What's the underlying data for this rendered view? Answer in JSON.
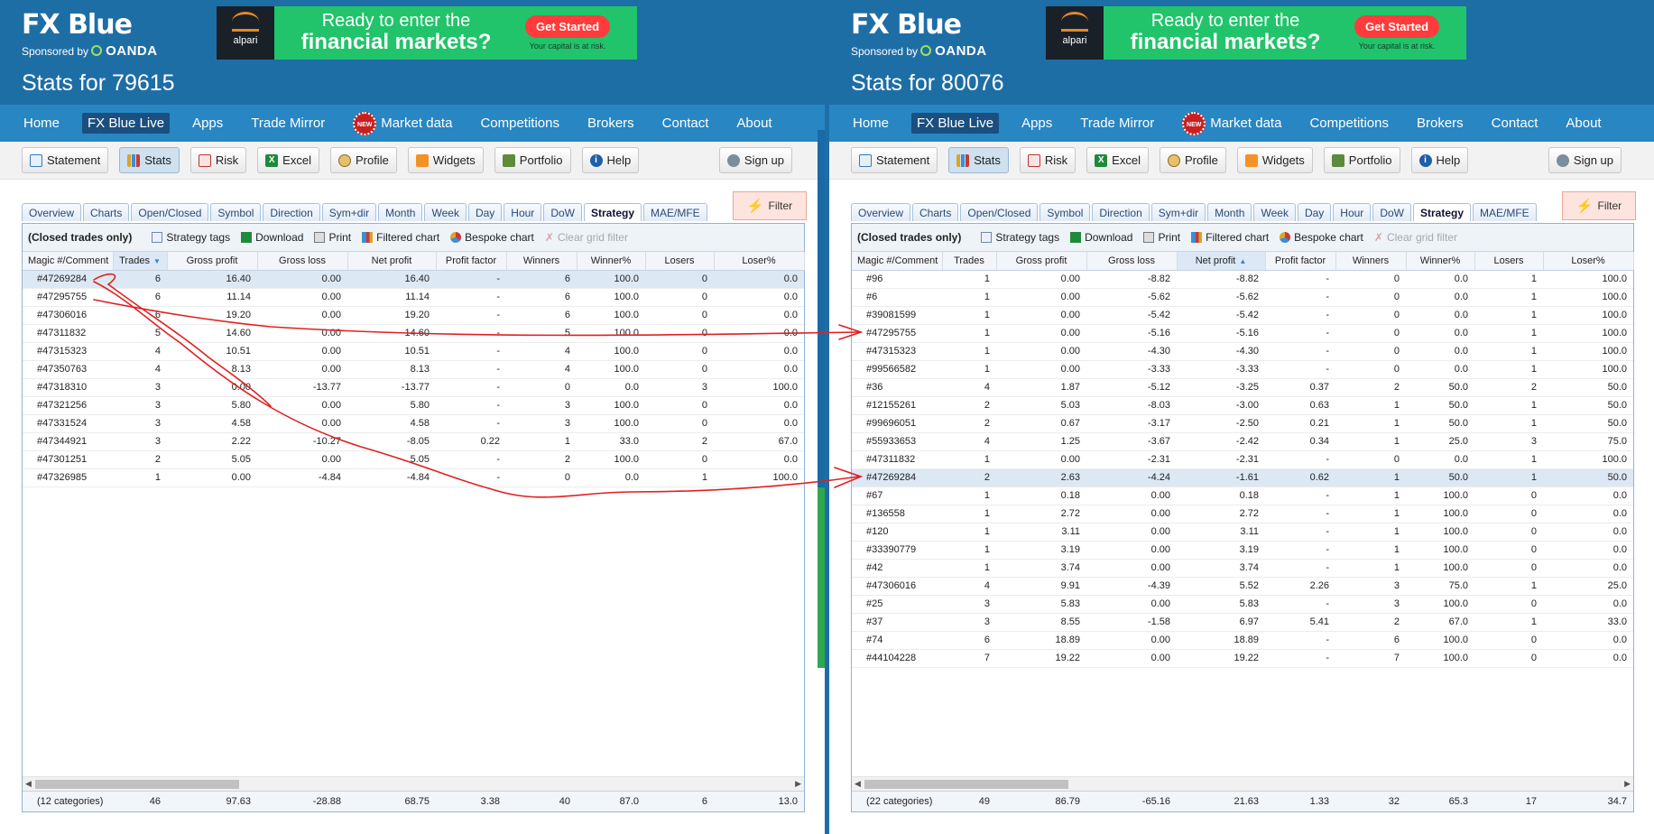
{
  "brand": {
    "logo": "FX Blue",
    "sponsored_by": "Sponsored by",
    "sponsor": "OANDA"
  },
  "ad": {
    "logo_text": "alpari",
    "line1": "Ready to enter the",
    "line2": "financial markets?",
    "button": "Get Started",
    "disclaimer": "Your capital is at risk."
  },
  "nav": [
    {
      "label": "Home",
      "active": false
    },
    {
      "label": "FX Blue Live",
      "active": true
    },
    {
      "label": "Apps",
      "active": false
    },
    {
      "label": "Trade Mirror",
      "active": false
    },
    {
      "label": "Market data",
      "active": false,
      "badge": "NEW"
    },
    {
      "label": "Competitions",
      "active": false
    },
    {
      "label": "Brokers",
      "active": false
    },
    {
      "label": "Contact",
      "active": false
    },
    {
      "label": "About",
      "active": false
    }
  ],
  "toolbar": [
    {
      "label": "Statement",
      "icon": "doc"
    },
    {
      "label": "Stats",
      "icon": "bars",
      "active": true
    },
    {
      "label": "Risk",
      "icon": "risk"
    },
    {
      "label": "Excel",
      "icon": "xl"
    },
    {
      "label": "Profile",
      "icon": "prof"
    },
    {
      "label": "Widgets",
      "icon": "rss"
    },
    {
      "label": "Portfolio",
      "icon": "port"
    },
    {
      "label": "Help",
      "icon": "help"
    }
  ],
  "signup": "Sign up",
  "tabs": [
    "Overview",
    "Charts",
    "Open/Closed",
    "Symbol",
    "Direction",
    "Sym+dir",
    "Month",
    "Week",
    "Day",
    "Hour",
    "DoW",
    "Strategy",
    "MAE/MFE"
  ],
  "active_tab": "Strategy",
  "filter": "Filter",
  "grid_toolbar": {
    "closed_only": "(Closed trades only)",
    "strategy_tags": "Strategy tags",
    "download": "Download",
    "print": "Print",
    "filtered_chart": "Filtered chart",
    "bespoke_chart": "Bespoke chart",
    "clear_filter": "Clear grid filter"
  },
  "columns": [
    "Magic #/Comment",
    "Trades",
    "Gross profit",
    "Gross loss",
    "Net profit",
    "Profit factor",
    "Winners",
    "Winner%",
    "Losers",
    "Loser%"
  ],
  "colors": {
    "header_blue": "#1e6ea6",
    "nav_blue": "#2886c3",
    "arrow_red": "#e02020",
    "ad_green": "#21c46a"
  },
  "panels": [
    {
      "title": "Stats for 79615",
      "sort_col": 1,
      "sort_dir": "desc",
      "rows": [
        [
          "#47269284",
          "6",
          "16.40",
          "0.00",
          "16.40",
          "-",
          "6",
          "100.0",
          "0",
          "0.0"
        ],
        [
          "#47295755",
          "6",
          "11.14",
          "0.00",
          "11.14",
          "-",
          "6",
          "100.0",
          "0",
          "0.0"
        ],
        [
          "#47306016",
          "6",
          "19.20",
          "0.00",
          "19.20",
          "-",
          "6",
          "100.0",
          "0",
          "0.0"
        ],
        [
          "#47311832",
          "5",
          "14.60",
          "0.00",
          "14.60",
          "-",
          "5",
          "100.0",
          "0",
          "0.0"
        ],
        [
          "#47315323",
          "4",
          "10.51",
          "0.00",
          "10.51",
          "-",
          "4",
          "100.0",
          "0",
          "0.0"
        ],
        [
          "#47350763",
          "4",
          "8.13",
          "0.00",
          "8.13",
          "-",
          "4",
          "100.0",
          "0",
          "0.0"
        ],
        [
          "#47318310",
          "3",
          "0.00",
          "-13.77",
          "-13.77",
          "-",
          "0",
          "0.0",
          "3",
          "100.0"
        ],
        [
          "#47321256",
          "3",
          "5.80",
          "0.00",
          "5.80",
          "-",
          "3",
          "100.0",
          "0",
          "0.0"
        ],
        [
          "#47331524",
          "3",
          "4.58",
          "0.00",
          "4.58",
          "-",
          "3",
          "100.0",
          "0",
          "0.0"
        ],
        [
          "#47344921",
          "3",
          "2.22",
          "-10.27",
          "-8.05",
          "0.22",
          "1",
          "33.0",
          "2",
          "67.0"
        ],
        [
          "#47301251",
          "2",
          "5.05",
          "0.00",
          "5.05",
          "-",
          "2",
          "100.0",
          "0",
          "0.0"
        ],
        [
          "#47326985",
          "1",
          "0.00",
          "-4.84",
          "-4.84",
          "-",
          "0",
          "0.0",
          "1",
          "100.0"
        ]
      ],
      "selected_row": 0,
      "footer": [
        "(12 categories)",
        "46",
        "97.63",
        "-28.88",
        "68.75",
        "3.38",
        "40",
        "87.0",
        "6",
        "13.0"
      ]
    },
    {
      "title": "Stats for 80076",
      "sort_col": 4,
      "sort_dir": "asc",
      "rows": [
        [
          "#96",
          "1",
          "0.00",
          "-8.82",
          "-8.82",
          "-",
          "0",
          "0.0",
          "1",
          "100.0"
        ],
        [
          "#6",
          "1",
          "0.00",
          "-5.62",
          "-5.62",
          "-",
          "0",
          "0.0",
          "1",
          "100.0"
        ],
        [
          "#39081599",
          "1",
          "0.00",
          "-5.42",
          "-5.42",
          "-",
          "0",
          "0.0",
          "1",
          "100.0"
        ],
        [
          "#47295755",
          "1",
          "0.00",
          "-5.16",
          "-5.16",
          "-",
          "0",
          "0.0",
          "1",
          "100.0"
        ],
        [
          "#47315323",
          "1",
          "0.00",
          "-4.30",
          "-4.30",
          "-",
          "0",
          "0.0",
          "1",
          "100.0"
        ],
        [
          "#99566582",
          "1",
          "0.00",
          "-3.33",
          "-3.33",
          "-",
          "0",
          "0.0",
          "1",
          "100.0"
        ],
        [
          "#36",
          "4",
          "1.87",
          "-5.12",
          "-3.25",
          "0.37",
          "2",
          "50.0",
          "2",
          "50.0"
        ],
        [
          "#12155261",
          "2",
          "5.03",
          "-8.03",
          "-3.00",
          "0.63",
          "1",
          "50.0",
          "1",
          "50.0"
        ],
        [
          "#99696051",
          "2",
          "0.67",
          "-3.17",
          "-2.50",
          "0.21",
          "1",
          "50.0",
          "1",
          "50.0"
        ],
        [
          "#55933653",
          "4",
          "1.25",
          "-3.67",
          "-2.42",
          "0.34",
          "1",
          "25.0",
          "3",
          "75.0"
        ],
        [
          "#47311832",
          "1",
          "0.00",
          "-2.31",
          "-2.31",
          "-",
          "0",
          "0.0",
          "1",
          "100.0"
        ],
        [
          "#47269284",
          "2",
          "2.63",
          "-4.24",
          "-1.61",
          "0.62",
          "1",
          "50.0",
          "1",
          "50.0"
        ],
        [
          "#67",
          "1",
          "0.18",
          "0.00",
          "0.18",
          "-",
          "1",
          "100.0",
          "0",
          "0.0"
        ],
        [
          "#136558",
          "1",
          "2.72",
          "0.00",
          "2.72",
          "-",
          "1",
          "100.0",
          "0",
          "0.0"
        ],
        [
          "#120",
          "1",
          "3.11",
          "0.00",
          "3.11",
          "-",
          "1",
          "100.0",
          "0",
          "0.0"
        ],
        [
          "#33390779",
          "1",
          "3.19",
          "0.00",
          "3.19",
          "-",
          "1",
          "100.0",
          "0",
          "0.0"
        ],
        [
          "#42",
          "1",
          "3.74",
          "0.00",
          "3.74",
          "-",
          "1",
          "100.0",
          "0",
          "0.0"
        ],
        [
          "#47306016",
          "4",
          "9.91",
          "-4.39",
          "5.52",
          "2.26",
          "3",
          "75.0",
          "1",
          "25.0"
        ],
        [
          "#25",
          "3",
          "5.83",
          "0.00",
          "5.83",
          "-",
          "3",
          "100.0",
          "0",
          "0.0"
        ],
        [
          "#37",
          "3",
          "8.55",
          "-1.58",
          "6.97",
          "5.41",
          "2",
          "67.0",
          "1",
          "33.0"
        ],
        [
          "#74",
          "6",
          "18.89",
          "0.00",
          "18.89",
          "-",
          "6",
          "100.0",
          "0",
          "0.0"
        ],
        [
          "#44104228",
          "7",
          "19.22",
          "0.00",
          "19.22",
          "-",
          "7",
          "100.0",
          "0",
          "0.0"
        ]
      ],
      "selected_row": 11,
      "footer": [
        "(22 categories)",
        "49",
        "86.79",
        "-65.16",
        "21.63",
        "1.33",
        "32",
        "65.3",
        "17",
        "34.7"
      ]
    }
  ]
}
